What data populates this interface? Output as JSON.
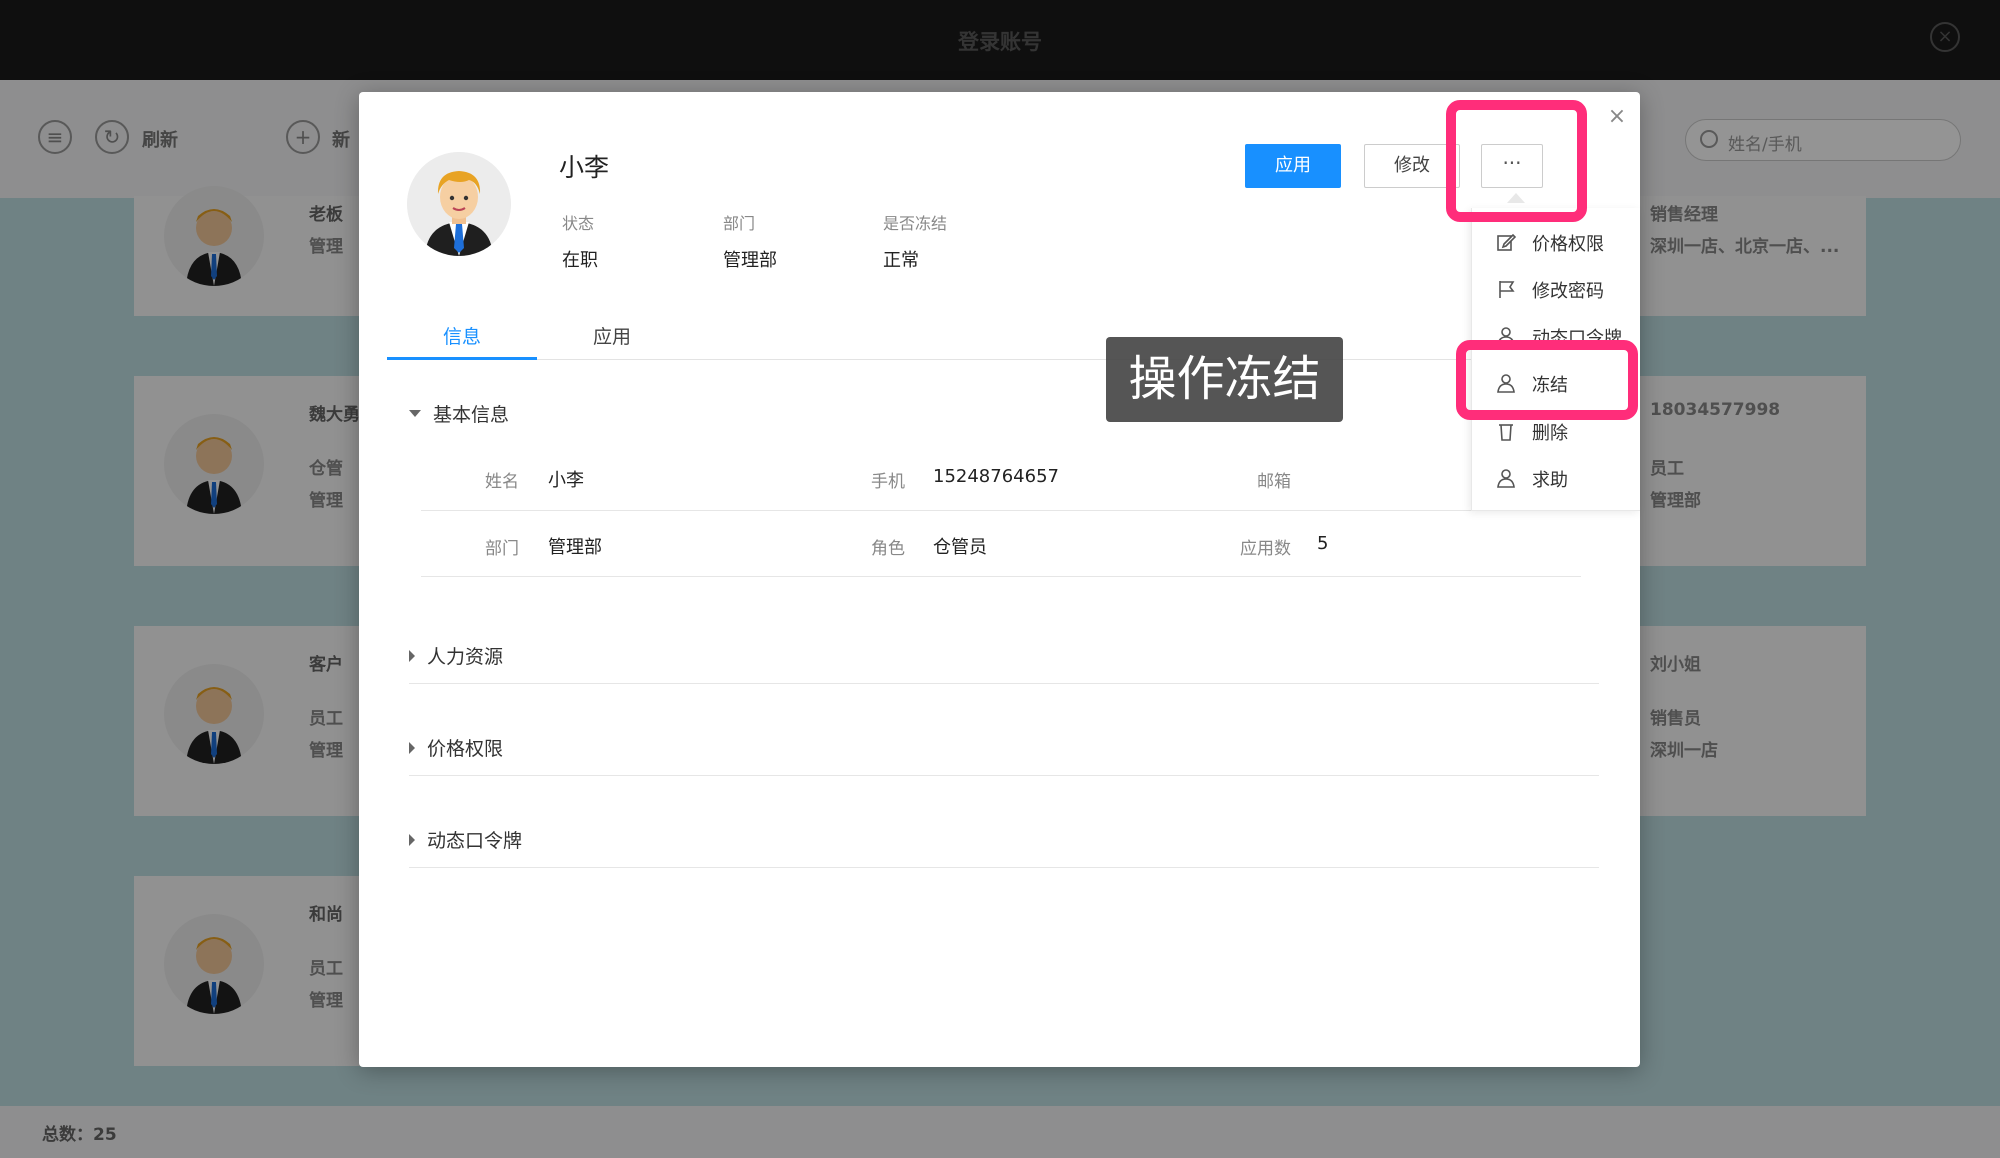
{
  "app": {
    "window_title": "登录账号",
    "toolbar": {
      "refresh_label": "刷新",
      "new_label": "新"
    },
    "search": {
      "placeholder": "姓名/手机"
    },
    "cards_left": [
      {
        "title": "老板",
        "line2": "管理"
      },
      {
        "title": "魏大勇",
        "line2": "仓管",
        "line3": "管理"
      },
      {
        "title": "客户",
        "line2": "员工",
        "line3": "管理"
      },
      {
        "title": "和尚",
        "line2": "员工",
        "line3": "管理"
      }
    ],
    "cards_right": [
      {
        "line1": "销售经理",
        "line2": "深圳一店、北京一店、..."
      },
      {
        "line1": "18034577998",
        "line2": "员工",
        "line3": "管理部"
      },
      {
        "line1": "刘小姐",
        "line2": "销售员",
        "line3": "深圳一店"
      }
    ],
    "footer": {
      "total": "总数：25"
    }
  },
  "modal": {
    "name": "小李",
    "fields": [
      {
        "label": "状态",
        "value": "在职"
      },
      {
        "label": "部门",
        "value": "管理部"
      },
      {
        "label": "是否冻结",
        "value": "正常"
      }
    ],
    "buttons": {
      "apply": "应用",
      "edit": "修改",
      "more": "···"
    },
    "close": "×",
    "tabs": [
      {
        "label": "信息",
        "active": true
      },
      {
        "label": "应用",
        "active": false
      }
    ],
    "basic_info": {
      "title": "基本信息",
      "rows": [
        [
          {
            "label": "姓名",
            "value": "小李"
          },
          {
            "label": "手机",
            "value": "15248764657"
          },
          {
            "label": "邮箱",
            "value": ""
          }
        ],
        [
          {
            "label": "部门",
            "value": "管理部"
          },
          {
            "label": "角色",
            "value": "仓管员"
          },
          {
            "label": "应用数",
            "value": "5"
          }
        ]
      ]
    },
    "sections": [
      "人力资源",
      "价格权限",
      "动态口令牌"
    ]
  },
  "dropdown": {
    "items": [
      {
        "label": "价格权限",
        "icon": "edit-icon"
      },
      {
        "label": "修改密码",
        "icon": "flag-icon"
      },
      {
        "label": "动态口令牌",
        "icon": "user-icon"
      },
      {
        "label": "冻结",
        "icon": "user-icon"
      },
      {
        "label": "删除",
        "icon": "trash-icon"
      },
      {
        "label": "求助",
        "icon": "user-icon"
      }
    ]
  },
  "annotation": {
    "callout": "操作冻结",
    "highlight_color": "#ff2d7a"
  },
  "colors": {
    "primary": "#1890ff",
    "highlight": "#ff2d7a"
  }
}
